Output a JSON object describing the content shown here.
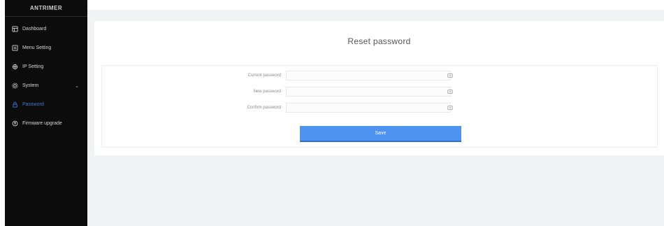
{
  "sidebar": {
    "brand": "ANTRIMER",
    "items": [
      {
        "label": "Dashboard",
        "icon": "dashboard-icon"
      },
      {
        "label": "Menu Setting",
        "icon": "menu-icon"
      },
      {
        "label": "IP Setting",
        "icon": "network-icon"
      },
      {
        "label": "System",
        "icon": "gear-icon",
        "caret": "⌄"
      },
      {
        "label": "Password",
        "icon": "lock-icon",
        "active": true
      },
      {
        "label": "Firmware upgrade",
        "icon": "upgrade-icon"
      }
    ]
  },
  "page": {
    "title": "Reset password"
  },
  "form": {
    "current_label": "Current password",
    "new_label": "New password",
    "confirm_label": "Confirm password",
    "current_value": "",
    "new_value": "",
    "confirm_value": "",
    "save_label": "Save"
  },
  "colors": {
    "accent": "#4f93f0",
    "sidebar_bg": "#0c0c0c",
    "active_item": "#3b7ddd"
  }
}
